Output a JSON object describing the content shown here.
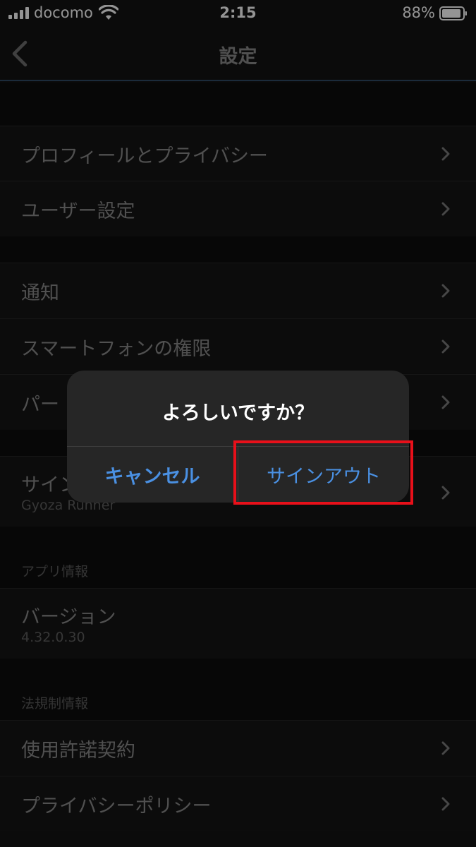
{
  "status": {
    "carrier": "docomo",
    "time": "2:15",
    "battery": "88%"
  },
  "nav": {
    "title": "設定"
  },
  "sections": {
    "s1": [
      {
        "label": "プロフィールとプライバシー"
      },
      {
        "label": "ユーザー設定"
      }
    ],
    "s2": [
      {
        "label": "通知"
      },
      {
        "label": "スマートフォンの権限"
      },
      {
        "label": "パー"
      }
    ],
    "signin": {
      "label": "サイン",
      "sub": "Gyoza Runner"
    },
    "app_info": {
      "header": "アプリ情報",
      "version_label": "バージョン",
      "version_value": "4.32.0.30"
    },
    "legal": {
      "header": "法規制情報",
      "items": [
        {
          "label": "使用許諾契約"
        },
        {
          "label": "プライバシーポリシー"
        }
      ]
    }
  },
  "alert": {
    "title": "よろしいですか？",
    "cancel": "キャンセル",
    "confirm": "サインアウト"
  },
  "colors": {
    "accent": "#4a90e2",
    "highlight": "#e8101a"
  }
}
